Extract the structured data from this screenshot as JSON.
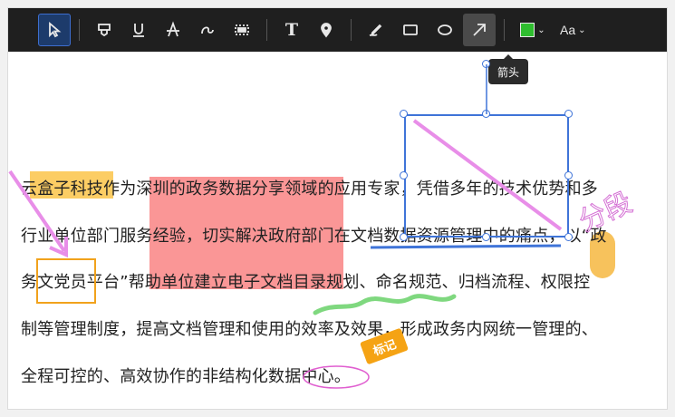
{
  "toolbar": {
    "tools": [
      {
        "name": "select-tool",
        "icon": "cursor-icon",
        "selected": true
      },
      {
        "name": "marker-tool",
        "icon": "highlighter-icon"
      },
      {
        "name": "underline-tool",
        "icon": "underline-icon"
      },
      {
        "name": "strikethrough-tool",
        "icon": "strikethrough-icon"
      },
      {
        "name": "squiggle-tool",
        "icon": "squiggle-icon"
      },
      {
        "name": "area-highlight-tool",
        "icon": "area-icon"
      },
      {
        "name": "text-tool",
        "icon": "text-icon",
        "glyph": "T"
      },
      {
        "name": "pin-tool",
        "icon": "map-pin-icon"
      },
      {
        "name": "pen-tool",
        "icon": "pen-icon"
      },
      {
        "name": "rectangle-tool",
        "icon": "rectangle-icon"
      },
      {
        "name": "ellipse-tool",
        "icon": "ellipse-icon"
      },
      {
        "name": "arrow-tool",
        "icon": "arrow-icon",
        "active": true
      }
    ],
    "color": "#2ebd2e",
    "font_label": "Aa"
  },
  "tooltip": {
    "text": "箭头"
  },
  "document": {
    "lines": [
      "云盒子科技作为深圳的政务数据分享领域的应用专家，凭借多年的技术优势和多",
      "行业单位部门服务经验，切实解决政府部门在文档数据资源管理中的痛点，以“政",
      "务文党员平台”帮助单位建立电子文档目录规划、命名规范、归档流程、权限控",
      "制等管理制度，提高文档管理和使用的效率及效果，形成政务内网统一管理的、",
      "全程可控的、高效协作的非结构化数据中心。"
    ]
  },
  "annotations": {
    "handwritten_text": "分段",
    "tag_label": "标记",
    "colors": {
      "highlight_red": "#f87878",
      "highlight_yellow": "#fbc242",
      "arrow": "#e88ee8",
      "selection": "#3f74d8",
      "squiggle": "#7fd87f",
      "box": "#f1a21c"
    }
  }
}
